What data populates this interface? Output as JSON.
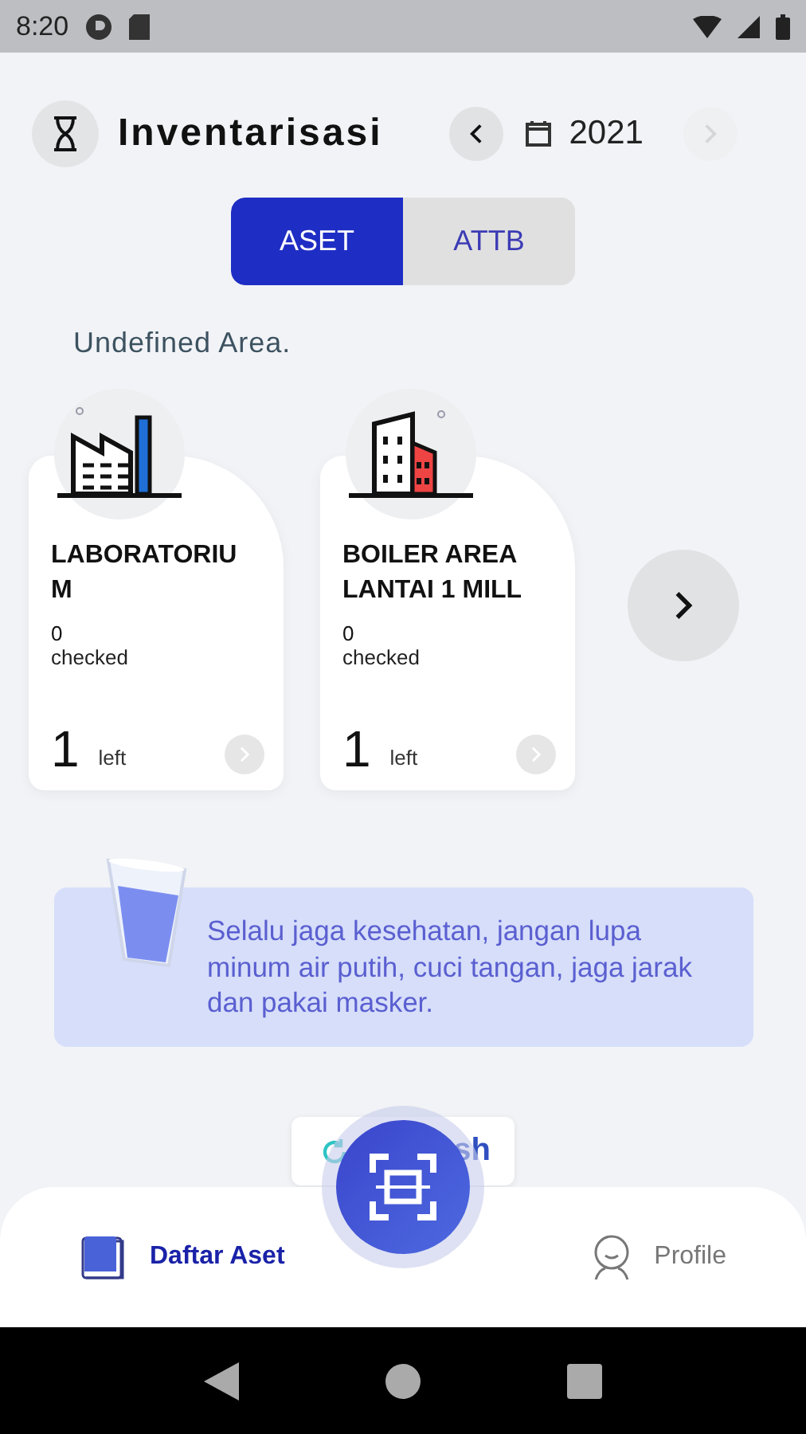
{
  "status_bar": {
    "time": "8:20"
  },
  "header": {
    "title": "Inventarisasi",
    "year": "2021",
    "prev_disabled": false,
    "next_disabled": true
  },
  "tabs": [
    {
      "label": "ASET",
      "selected": true
    },
    {
      "label": "ATTB",
      "selected": false
    }
  ],
  "area_title": "Undefined Area.",
  "cards": [
    {
      "kind": "factory",
      "name": "LABORATORIU M",
      "checked_count": "0",
      "checked_label": "checked",
      "left_count": "1",
      "left_label": "left"
    },
    {
      "kind": "building",
      "name": "BOILER AREA LANTAI 1 MILL",
      "checked_count": "0",
      "checked_label": "checked",
      "left_count": "1",
      "left_label": "left"
    }
  ],
  "banner": {
    "text": "Selalu jaga kesehatan, jangan lupa minum air putih, cuci tangan, jaga jarak dan pakai masker."
  },
  "refresh_button": {
    "label": "sh"
  },
  "bottom_nav": [
    {
      "kind": "list",
      "label": "Daftar Aset",
      "selected": true
    },
    {
      "kind": "profile",
      "label": "Profile",
      "selected": false
    }
  ]
}
